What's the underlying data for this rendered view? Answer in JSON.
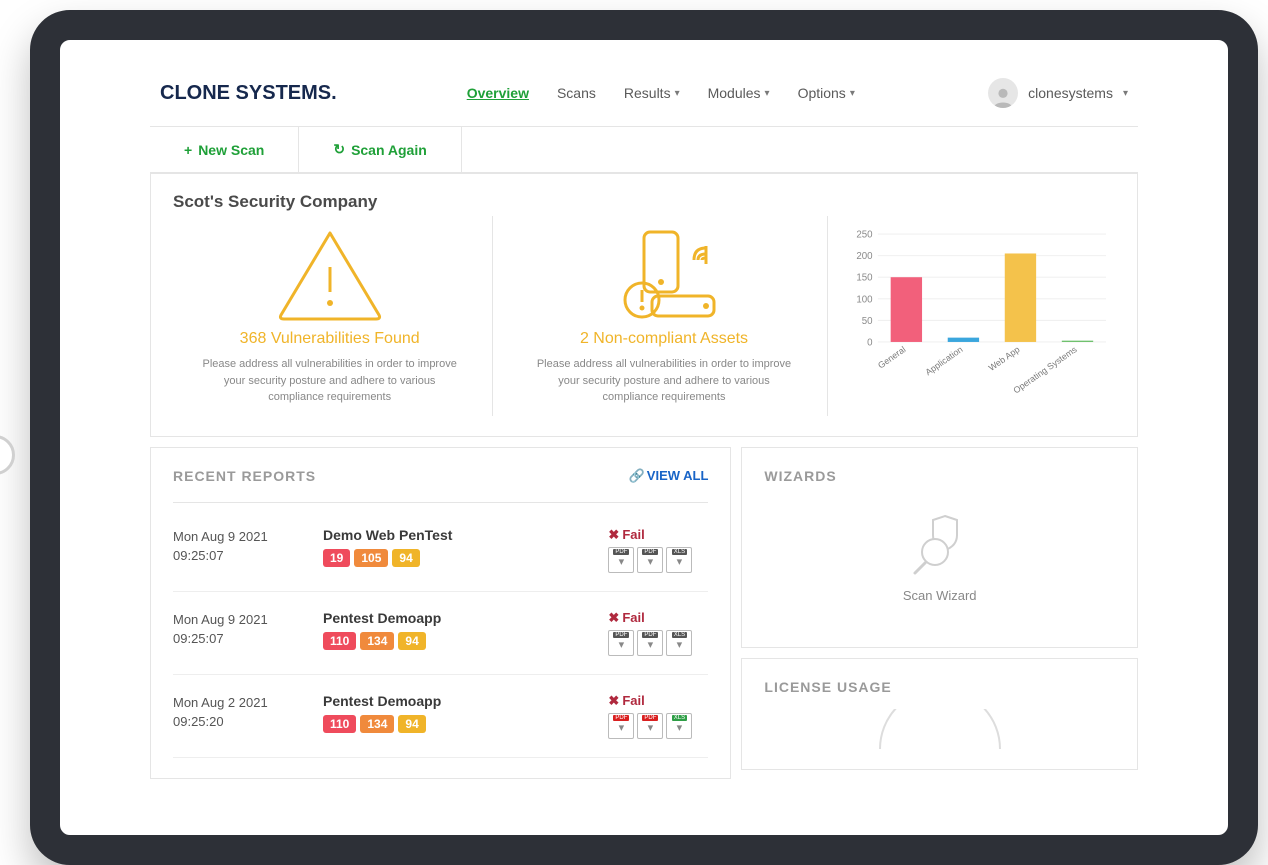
{
  "brand": "CLONE SYSTEMS.",
  "nav": {
    "overview": "Overview",
    "scans": "Scans",
    "results": "Results",
    "modules": "Modules",
    "options": "Options"
  },
  "user": {
    "name": "clonesystems"
  },
  "actions": {
    "new_scan": "New Scan",
    "scan_again": "Scan Again"
  },
  "company": "Scot's Security Company",
  "vuln_card": {
    "title": "368 Vulnerabilities Found",
    "desc": "Please address all vulnerabilities in order to improve your security posture and adhere to various compliance requirements"
  },
  "assets_card": {
    "title": "2 Non-compliant Assets",
    "desc": "Please address all vulnerabilities in order to improve your security posture and adhere to various compliance requirements"
  },
  "chart_data": {
    "type": "bar",
    "categories": [
      "General",
      "Application",
      "Web App",
      "Operating Systems"
    ],
    "values": [
      150,
      10,
      205,
      3
    ],
    "colors": [
      "#f2607b",
      "#3aa6dd",
      "#f4c24b",
      "#6abf69"
    ],
    "ylim": [
      0,
      250
    ],
    "yticks": [
      0,
      50,
      100,
      150,
      200,
      250
    ]
  },
  "reports": {
    "title": "RECENT REPORTS",
    "view_all": "VIEW ALL",
    "rows": [
      {
        "date_line1": "Mon Aug 9 2021",
        "date_line2": "09:25:07",
        "name": "Demo Web PenTest",
        "badges": [
          "19",
          "105",
          "94"
        ],
        "status": "Fail",
        "files": [
          "PDF",
          "PDF",
          "XLS"
        ],
        "file_style": "gray"
      },
      {
        "date_line1": "Mon Aug 9 2021",
        "date_line2": "09:25:07",
        "name": "Pentest Demoapp",
        "badges": [
          "110",
          "134",
          "94"
        ],
        "status": "Fail",
        "files": [
          "PDF",
          "PDF",
          "XLS"
        ],
        "file_style": "gray"
      },
      {
        "date_line1": "Mon Aug 2 2021",
        "date_line2": "09:25:20",
        "name": "Pentest Demoapp",
        "badges": [
          "110",
          "134",
          "94"
        ],
        "status": "Fail",
        "files": [
          "PDF",
          "PDF",
          "XLS"
        ],
        "file_style": "color"
      }
    ]
  },
  "wizards": {
    "title": "WIZARDS",
    "scan_wizard": "Scan Wizard"
  },
  "license": {
    "title": "LICENSE USAGE"
  }
}
